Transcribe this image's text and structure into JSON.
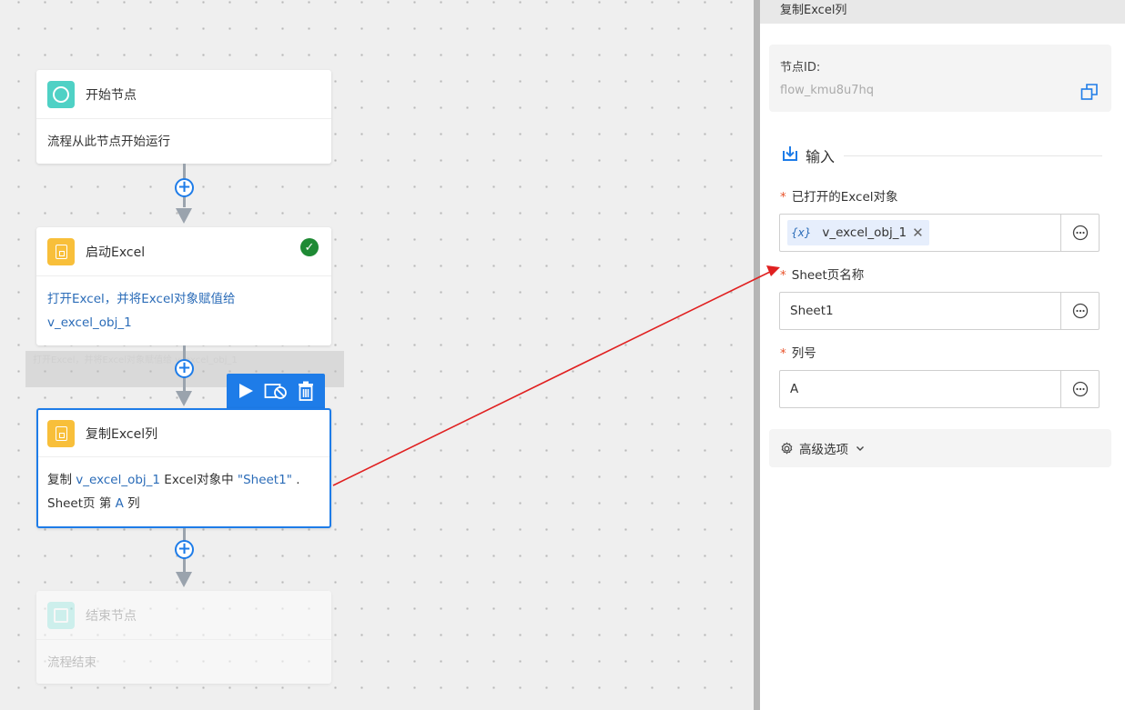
{
  "flow": {
    "nodes": [
      {
        "title": "开始节点",
        "desc": "流程从此节点开始运行"
      },
      {
        "title": "启动Excel",
        "desc_prefix": "打开Excel，并将Excel对象赋值给",
        "desc_var": "v_excel_obj_1",
        "status": "success"
      },
      {
        "title": "复制Excel列",
        "desc_a": "复制 ",
        "desc_var": "v_excel_obj_1",
        "desc_b": " Excel对象中 ",
        "desc_sheet": "\"Sheet1\"",
        "desc_c": " .",
        "desc_d": "Sheet页 第 ",
        "desc_col": "A",
        "desc_e": " 列"
      },
      {
        "title": "结束节点",
        "desc": "流程结束"
      }
    ],
    "ghost_text": "打开Excel，并将Excel对象赋值给 v_excel_obj_1"
  },
  "panel": {
    "title": "复制Excel列",
    "node_id_label": "节点ID:",
    "node_id_value": "flow_kmu8u7hq",
    "section_input": "输入",
    "fields": [
      {
        "label": "已打开的Excel对象",
        "chip_var": "{x}",
        "value": "v_excel_obj_1",
        "required": "*"
      },
      {
        "label": "Sheet页名称",
        "value": "Sheet1",
        "required": "*"
      },
      {
        "label": "列号",
        "value": "A",
        "required": "*"
      }
    ],
    "advanced": "高级选项"
  },
  "colors": {
    "accent": "#1e7ce8",
    "success": "#1e8a34",
    "required": "#e8532b",
    "annotation": "#e02020"
  }
}
